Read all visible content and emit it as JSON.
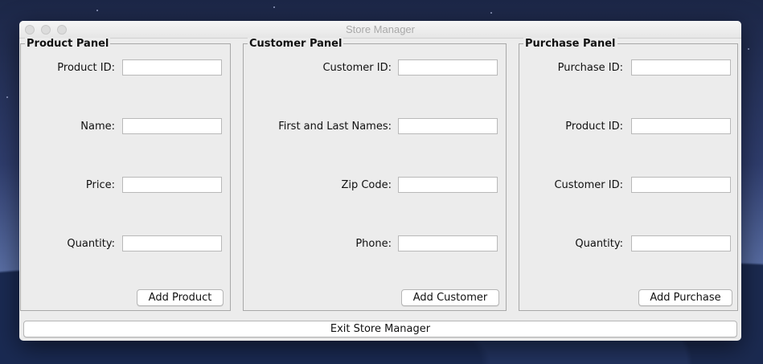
{
  "window": {
    "title": "Store Manager"
  },
  "product_panel": {
    "title": "Product Panel",
    "fields": [
      {
        "label": "Product ID:",
        "value": ""
      },
      {
        "label": "Name:",
        "value": ""
      },
      {
        "label": "Price:",
        "value": ""
      },
      {
        "label": "Quantity:",
        "value": ""
      }
    ],
    "button": "Add Product"
  },
  "customer_panel": {
    "title": "Customer Panel",
    "fields": [
      {
        "label": "Customer ID:",
        "value": ""
      },
      {
        "label": "First and Last Names:",
        "value": ""
      },
      {
        "label": "Zip Code:",
        "value": ""
      },
      {
        "label": "Phone:",
        "value": ""
      }
    ],
    "button": "Add Customer"
  },
  "purchase_panel": {
    "title": "Purchase Panel",
    "fields": [
      {
        "label": "Purchase ID:",
        "value": ""
      },
      {
        "label": "Product ID:",
        "value": ""
      },
      {
        "label": "Customer ID:",
        "value": ""
      },
      {
        "label": "Quantity:",
        "value": ""
      }
    ],
    "button": "Add Purchase"
  },
  "exit_button": "Exit Store Manager"
}
